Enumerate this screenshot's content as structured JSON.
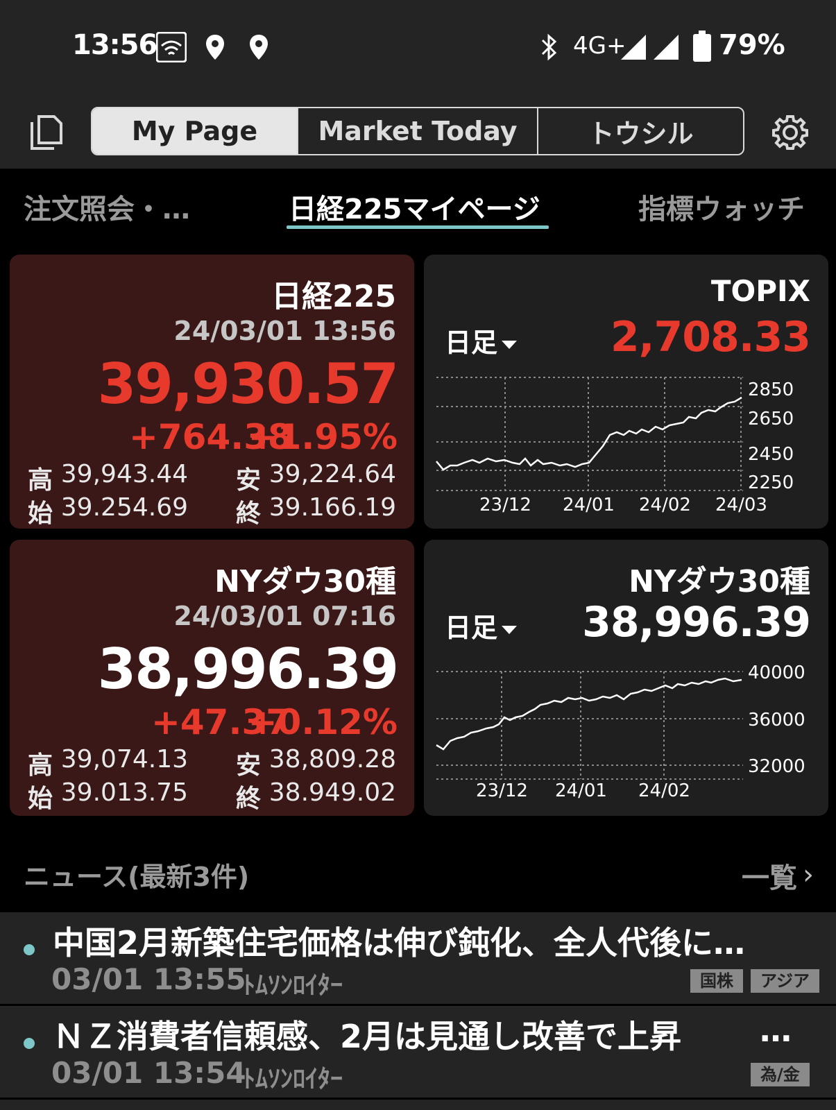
{
  "status": {
    "time": "13:56",
    "network": "4G+",
    "battery": "79%",
    "icons": [
      "wifi-icon",
      "location-icon",
      "location-icon",
      "bluetooth-icon",
      "signal-icon",
      "signal-icon",
      "battery-icon"
    ]
  },
  "toolbar": {
    "tabs": [
      "My Page",
      "Market Today",
      "トウシル"
    ],
    "active_tab": "My Page"
  },
  "subtabs": {
    "left": "注文照会・…",
    "center": "日経225マイページ",
    "right": "指標ウォッチ"
  },
  "nikkei": {
    "title": "日経225",
    "timestamp": "24/03/01 13:56",
    "value": "39,930.57",
    "change": "+764.38",
    "change_pct": "+1.95%",
    "high_label": "高",
    "high": "39,943.44",
    "low_label": "安",
    "low": "39,224.64",
    "open_label": "始",
    "open": "39.254.69",
    "close_label": "終",
    "close": "39.166.19"
  },
  "topix": {
    "title": "TOPIX",
    "period": "日足",
    "value": "2,708.33",
    "chart": {
      "y_ticks": [
        "2850",
        "2650",
        "2450",
        "2250"
      ],
      "x_ticks": [
        "23/12",
        "24/01",
        "24/02",
        "24/03"
      ]
    }
  },
  "dow": {
    "title": "NYダウ30種",
    "timestamp": "24/03/01 07:16",
    "value": "38,996.39",
    "change": "+47.37",
    "change_pct": "+0.12%",
    "high_label": "高",
    "high": "39,074.13",
    "low_label": "安",
    "low": "38,809.28",
    "open_label": "始",
    "open": "39.013.75",
    "close_label": "終",
    "close": "38.949.02"
  },
  "dow_chart_card": {
    "title": "NYダウ30種",
    "period": "日足",
    "value": "38,996.39",
    "chart": {
      "y_ticks": [
        "40000",
        "36000",
        "32000"
      ],
      "x_ticks": [
        "23/12",
        "24/01",
        "24/02"
      ]
    }
  },
  "news": {
    "header": "ニュース(最新3件)",
    "all_link": "一覧",
    "items": [
      {
        "headline": "中国2月新築住宅価格は伸び鈍化、全人代後に…",
        "date": "03/01 13:55",
        "source": "ﾄﾑｿﾝﾛｲﾀｰ",
        "tags": [
          "国株",
          "アジア"
        ]
      },
      {
        "headline": "ＮＺ消費者信頼感、2月は見通し改善で上昇",
        "ellipsis": "…",
        "date": "03/01 13:54",
        "source": "ﾄﾑｿﾝﾛｲﾀｰ",
        "tags": [
          "為/金"
        ]
      }
    ]
  },
  "colors": {
    "up": "#e83a2c",
    "accent": "#7ec7c9",
    "card_red": "#3a1818",
    "card_dark": "#1f1f1f"
  }
}
